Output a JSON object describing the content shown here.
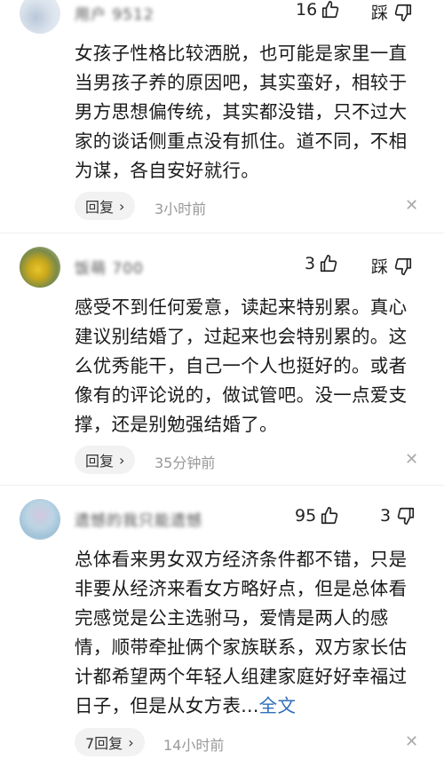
{
  "comments": [
    {
      "username": "用户 9512",
      "likes": "16",
      "dislike_label": "踩",
      "text": "女孩子性格比较洒脱，也可能是家里一直当男孩子养的原因吧，其实蛮好，相较于男方思想偏传统，其实都没错，只不过大家的谈话侧重点没有抓住。道不同，不相为谋，各自安好就行。",
      "reply_label": "回复",
      "reply_chevron": "›",
      "time": "3小时前",
      "close": "✕"
    },
    {
      "username": "饭萌 700",
      "likes": "3",
      "dislike_label": "踩",
      "text": "感受不到任何爱意，读起来特别累。真心建议别结婚了，过起来也会特别累的。这么优秀能干，自己一个人也挺好的。或者像有的评论说的，做试管吧。没一点爱支撑，还是别勉强结婚了。",
      "reply_label": "回复",
      "reply_chevron": "›",
      "time": "35分钟前",
      "close": "✕"
    },
    {
      "username": "遗憾的我只能遗憾",
      "likes": "95",
      "dislikes": "3",
      "text": "总体看来男女双方经济条件都不错，只是非要从经济来看女方略好点，但是总体看完感觉是公主选驸马，爱情是两人的感情，顺带牵扯俩个家族联系，双方家长估计都希望两个年轻人组建家庭好好幸福过日子，但是从女方表...",
      "more_label": "全文",
      "reply_label": "7回复",
      "reply_chevron": "›",
      "time": "14小时前",
      "close": "✕"
    }
  ],
  "icons": {
    "like": "thumbs-up-icon",
    "dislike": "thumbs-down-icon",
    "close": "close-icon"
  },
  "colors": {
    "text": "#1a1a1a",
    "meta": "#999999",
    "link": "#2f6fb8",
    "pill": "#f2f2f2"
  }
}
